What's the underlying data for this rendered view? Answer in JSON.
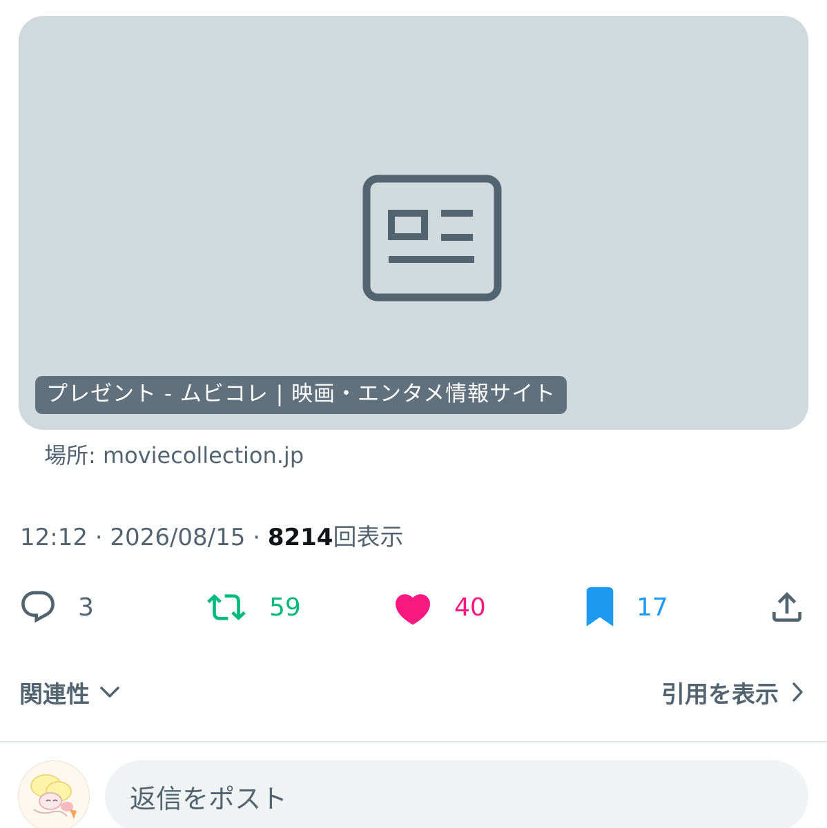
{
  "link_card": {
    "icon": "article-icon",
    "title": "プレゼント - ムビコレ | 映画・エンタメ情報サイト",
    "source": "場所: moviecollection.jp"
  },
  "meta": {
    "time": "12:12",
    "separator": "·",
    "date": "2026/08/15",
    "views_count": "8214",
    "views_label": "回表示"
  },
  "actions": {
    "reply": {
      "icon": "reply-icon",
      "count": "3",
      "color": "#536471"
    },
    "retweet": {
      "icon": "retweet-icon",
      "count": "59",
      "color": "#00ba7c"
    },
    "like": {
      "icon": "heart-icon",
      "count": "40",
      "color": "#f91880"
    },
    "bookmark": {
      "icon": "bookmark-icon",
      "count": "17",
      "color": "#1d9bf0"
    },
    "share": {
      "icon": "share-icon"
    }
  },
  "sort": {
    "label": "関連性",
    "icon": "chevron-down-icon"
  },
  "quotes": {
    "label": "引用を表示",
    "icon": "chevron-right-icon"
  },
  "composer": {
    "avatar": "avatar",
    "placeholder": "返信をポスト"
  }
}
